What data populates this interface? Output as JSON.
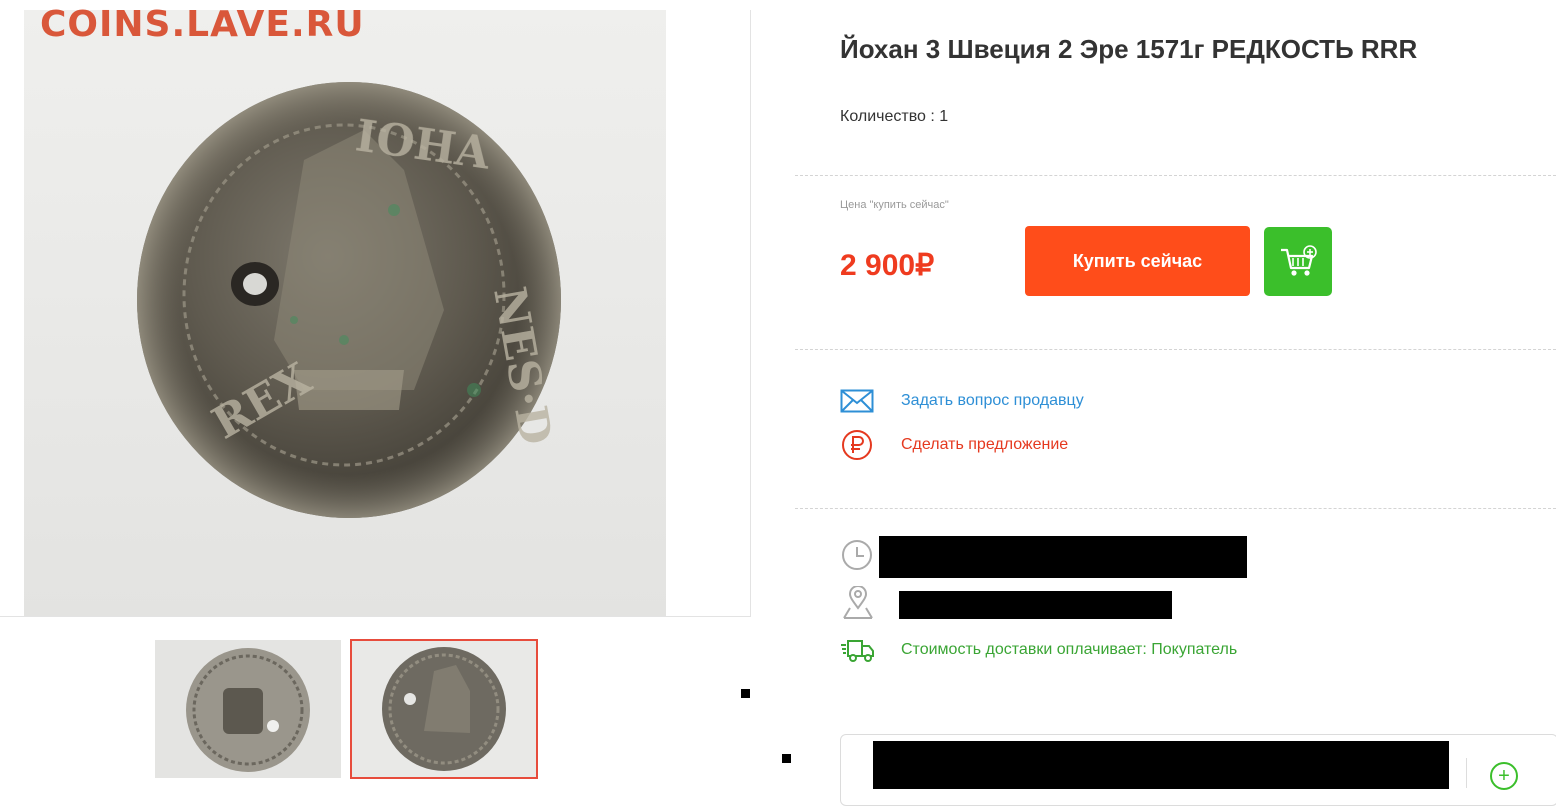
{
  "watermark": "COINS.LAVE.RU",
  "gallery": {
    "main_image_alt": "coin photo",
    "thumbnails": [
      "coin obverse thumbnail",
      "coin reverse thumbnail"
    ]
  },
  "lot": {
    "title": "Йохан 3 Швеция 2 Эре 1571г РЕДКОСТЬ RRR",
    "quantity": "Количество : 1",
    "price_label": "Цена \"купить сейчас\"",
    "price": "2 900₽",
    "buy_now_label": "Купить сейчас"
  },
  "actions": {
    "ask_seller": "Задать вопрос продавцу",
    "make_offer": "Сделать предложение"
  },
  "shipping": {
    "text": "Стоимость доставки оплачивает: Покупатель"
  },
  "colors": {
    "accent_red": "#ff4d1a",
    "price_red": "#ef3b1f",
    "cart_green": "#3bbf2b",
    "link_blue": "#2e8fd6"
  },
  "icons": [
    "mail-icon",
    "ruble-icon",
    "clock-icon",
    "location-icon",
    "truck-icon",
    "cart-plus-icon",
    "plus-circle-icon"
  ]
}
